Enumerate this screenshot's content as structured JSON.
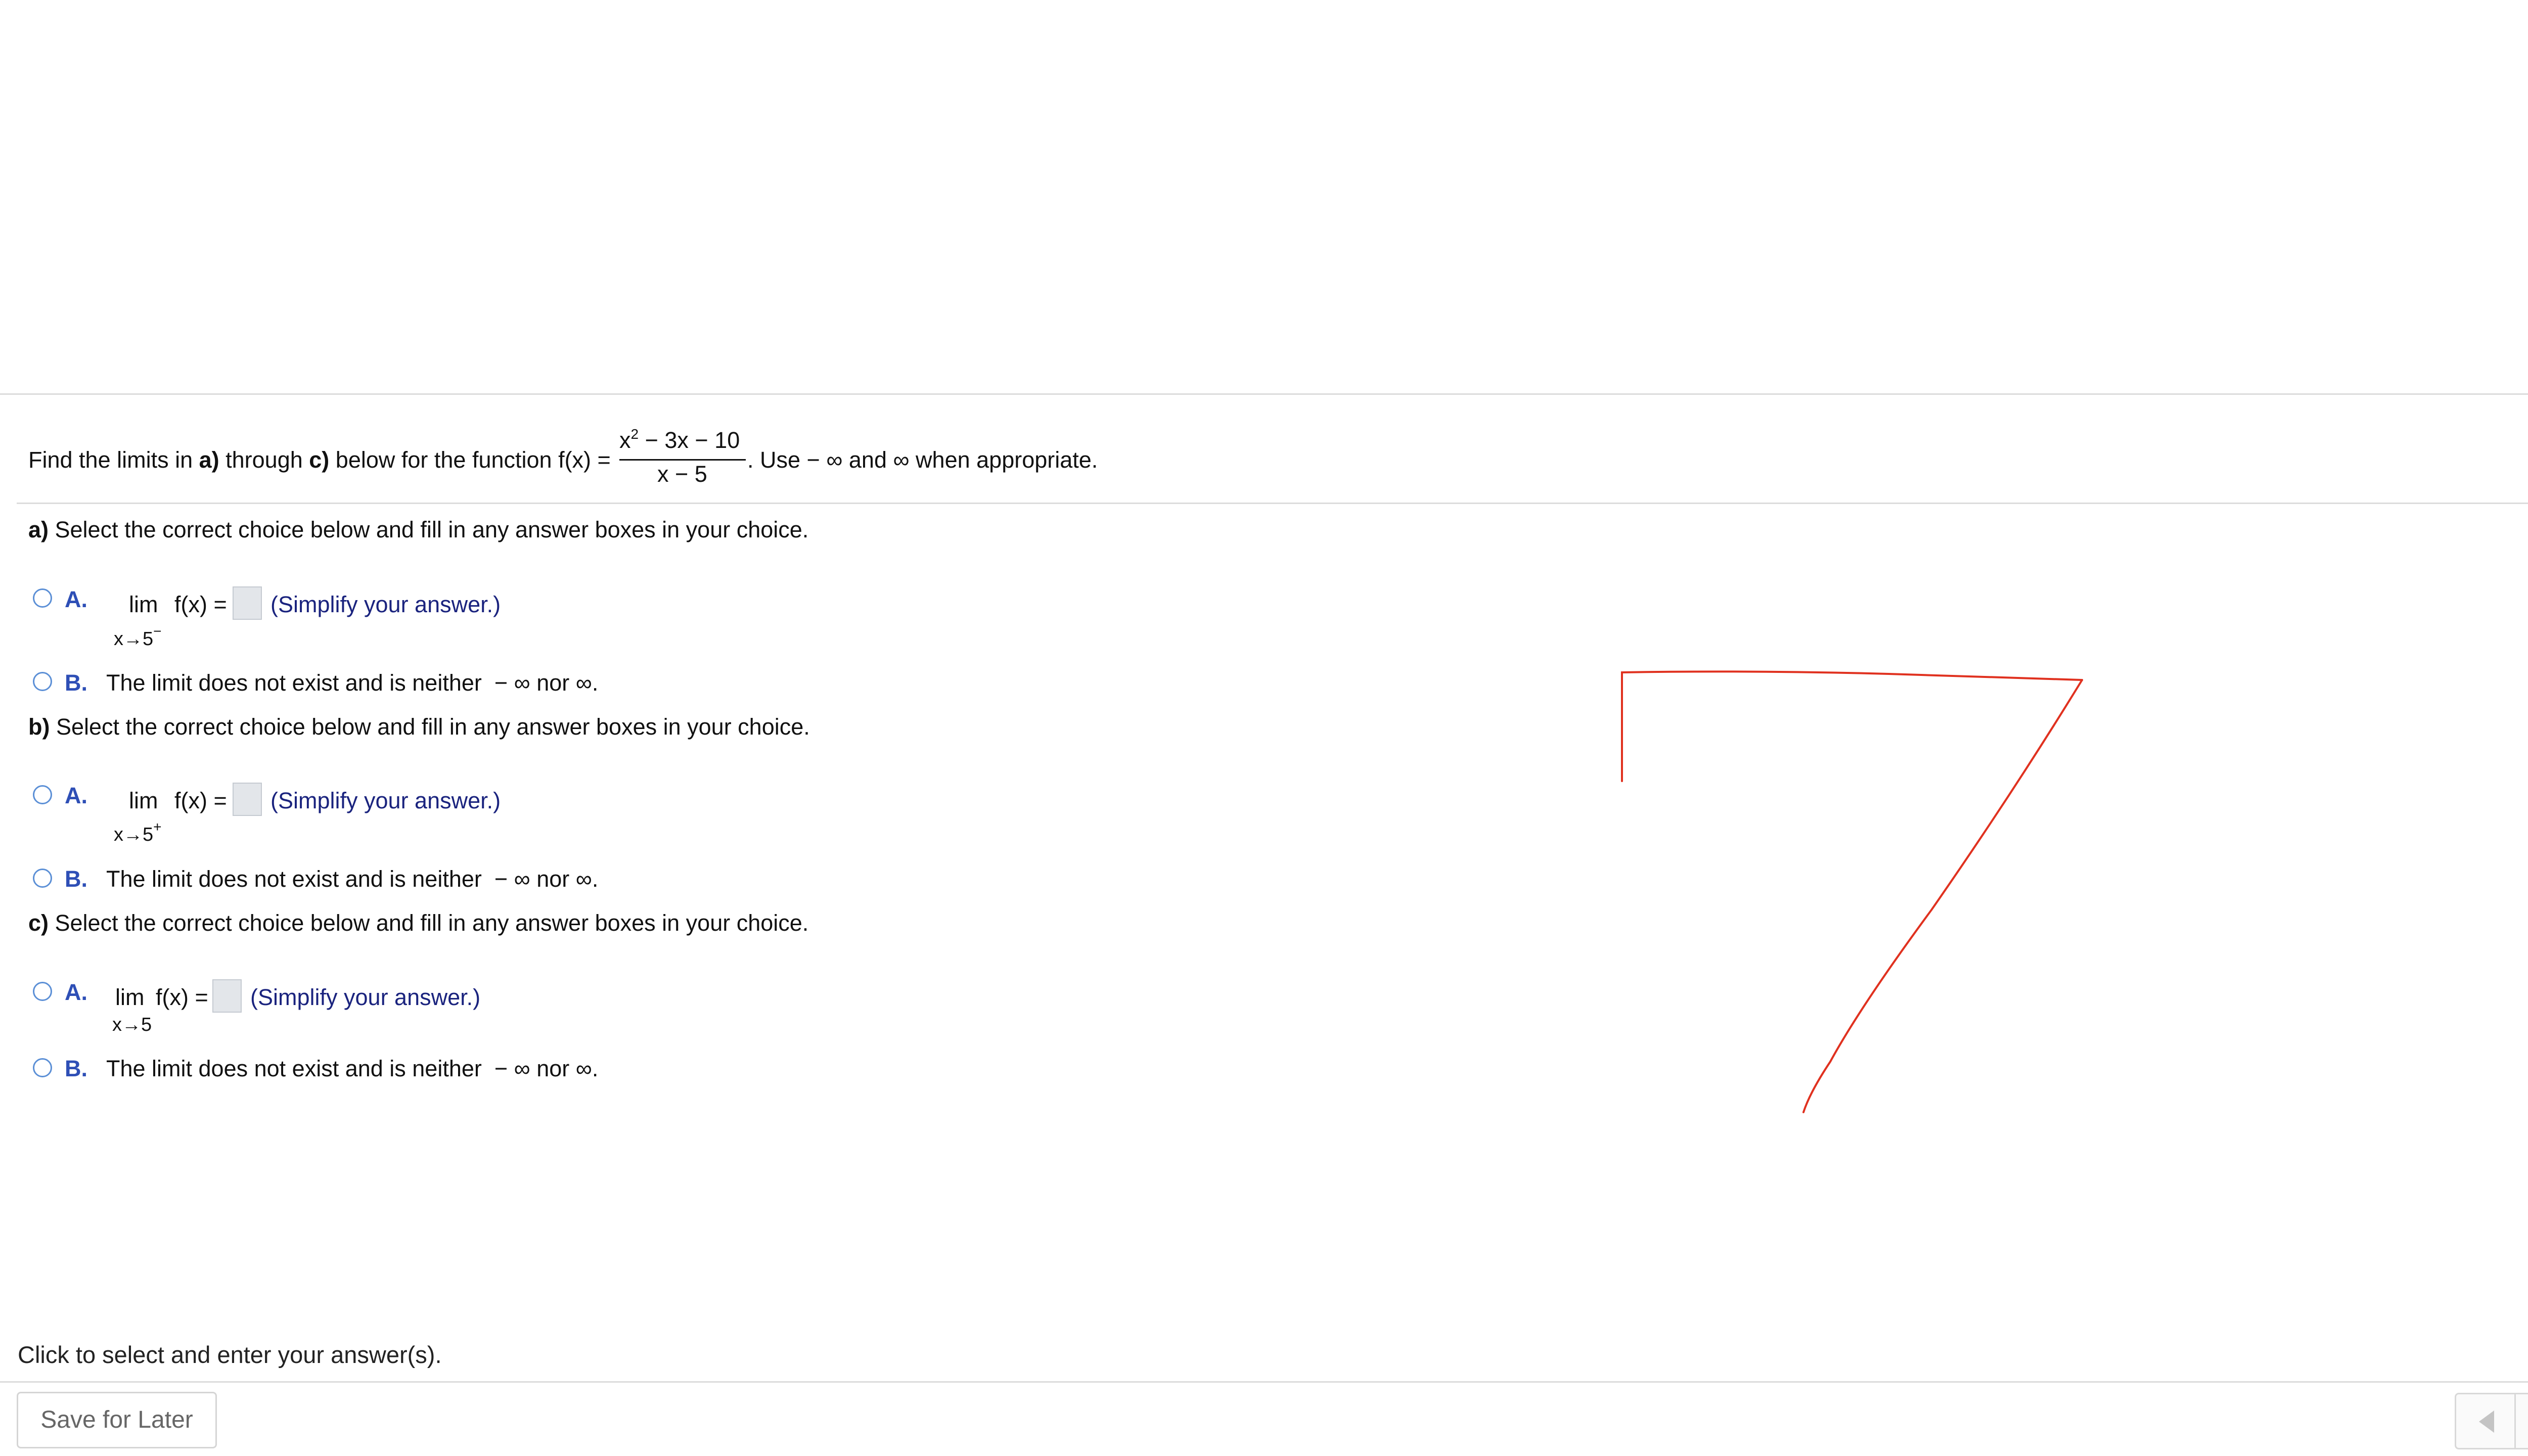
{
  "question": {
    "intro_pre": "Find the limits in ",
    "intro_a": "a)",
    "intro_mid": " through ",
    "intro_c": "c)",
    "intro_post": " below for the function f(x) =",
    "fraction_numerator": "x",
    "fraction_numerator_exp": "2",
    "fraction_numerator_rest": " − 3x − 10",
    "fraction_denominator": "x − 5",
    "intro_tail": ". Use  − ∞ and ∞ when appropriate."
  },
  "parts": [
    {
      "label": "a)",
      "prompt": " Select the correct choice below and fill in any answer boxes in your choice.",
      "choice_a_letter": "A.",
      "lim": "lim",
      "fx": "f(x) =",
      "approach": "x→5",
      "approach_sign": "−",
      "hint": "(Simplify your answer.)",
      "choice_b_letter": "B.",
      "choice_b_text": "The limit does not exist and is neither  − ∞ nor ∞."
    },
    {
      "label": "b)",
      "prompt": " Select the correct choice below and fill in any answer boxes in your choice.",
      "choice_a_letter": "A.",
      "lim": "lim",
      "fx": "f(x) =",
      "approach": "x→5",
      "approach_sign": "+",
      "hint": "(Simplify your answer.)",
      "choice_b_letter": "B.",
      "choice_b_text": "The limit does not exist and is neither  − ∞ nor ∞."
    },
    {
      "label": "c)",
      "prompt": " Select the correct choice below and fill in any answer boxes in your choice.",
      "choice_a_letter": "A.",
      "lim": "lim",
      "fx": "f(x) =",
      "approach": "x→5",
      "approach_sign": "",
      "hint": "(Simplify your answer.)",
      "choice_b_letter": "B.",
      "choice_b_text": "The limit does not exist and is neither  − ∞ nor ∞."
    }
  ],
  "footer": {
    "instruction": "Click to select and enter your answer(s).",
    "save_label": "Save for Later",
    "help_label": "?"
  },
  "icons": {
    "settings": "gear-icon",
    "help": "question-icon",
    "prev": "triangle-left-icon",
    "next": "triangle-right-icon"
  },
  "colors": {
    "choice_letter": "#2e4fb6",
    "hint": "#1a237e",
    "radio_border": "#5b8fd6",
    "help_bg": "#f2c12e",
    "annotation_stroke": "#e0311f"
  }
}
